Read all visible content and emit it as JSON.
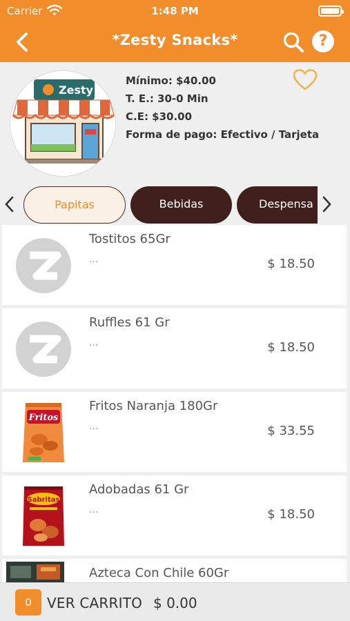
{
  "status_bar": {
    "carrier": "Carrier",
    "time": "1:48 PM"
  },
  "nav": {
    "title": "*Zesty Snacks*",
    "back_icon": "back-chevron-icon",
    "search_icon": "search-icon",
    "help_icon": "help-icon"
  },
  "store": {
    "logo_text": "Zesty",
    "minimo": "Mínimo: $40.00",
    "te": "T. E.: 30-0 Min",
    "ce": "C.E: $30.00",
    "pago": "Forma de pago: Efectivo / Tarjeta"
  },
  "tabs": [
    {
      "label": "Papitas"
    },
    {
      "label": "Bebidas"
    },
    {
      "label": "Despensa"
    }
  ],
  "products": [
    {
      "name": "Tostitos 65Gr",
      "desc": "...",
      "price": "$ 18.50"
    },
    {
      "name": "Ruffles 61 Gr",
      "desc": "...",
      "price": "$ 18.50"
    },
    {
      "name": "Fritos Naranja 180Gr",
      "desc": "...",
      "price": "$ 33.55"
    },
    {
      "name": "Adobadas 61 Gr",
      "desc": "...",
      "price": "$ 18.50"
    },
    {
      "name": "Azteca Con Chile 60Gr",
      "desc": "",
      "price": ""
    }
  ],
  "product_images": {
    "fritos_brand": "Fritos",
    "sabritas_brand": "Sabritas"
  },
  "cart": {
    "count": "0",
    "label": "VER CARRITO",
    "total": "$ 0.00"
  },
  "colors": {
    "brand_orange": "#f28d2c",
    "tab_dark": "#3f201c",
    "background": "#efefef"
  }
}
